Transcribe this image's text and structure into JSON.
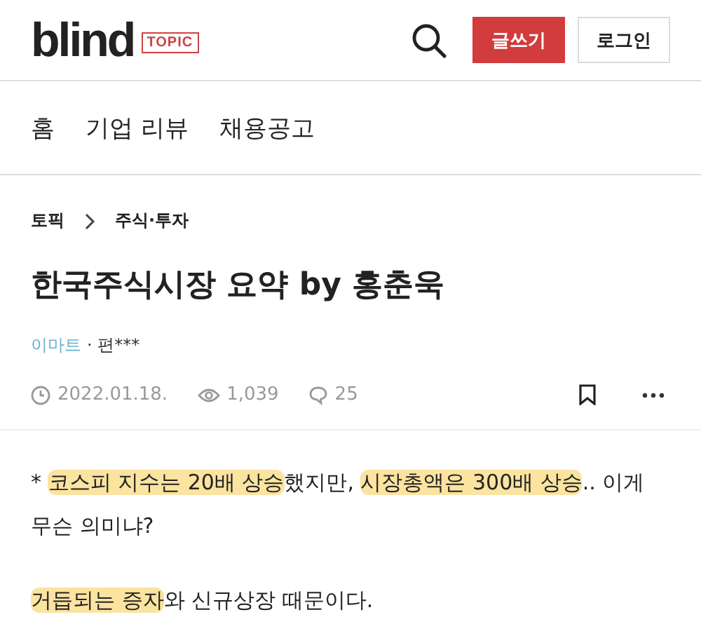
{
  "header": {
    "logo": "blind",
    "logo_tag": "TOPIC",
    "write_button": "글쓰기",
    "login_button": "로그인"
  },
  "nav": [
    {
      "label": "홈"
    },
    {
      "label": "기업 리뷰"
    },
    {
      "label": "채용공고"
    }
  ],
  "breadcrumb": [
    "토픽",
    "주식·투자"
  ],
  "post": {
    "title": "한국주식시장 요약 by 홍춘욱",
    "company": "이마트",
    "author": "· 편***",
    "date": "2022.01.18.",
    "views": "1,039",
    "comments": "25",
    "paragraphs": [
      [
        {
          "text": "* ",
          "highlighted": false
        },
        {
          "text": "코스피 지수는 20배 상승",
          "highlighted": true
        },
        {
          "text": "했지만, ",
          "highlighted": false
        },
        {
          "text": "시장총액은 300배 상승",
          "highlighted": true
        },
        {
          "text": ".. 이게 무슨 의미냐?",
          "highlighted": false
        }
      ],
      [
        {
          "text": "거듭되는 증자",
          "highlighted": true
        },
        {
          "text": "와 신규상장 때문이다.",
          "highlighted": false
        }
      ]
    ]
  }
}
